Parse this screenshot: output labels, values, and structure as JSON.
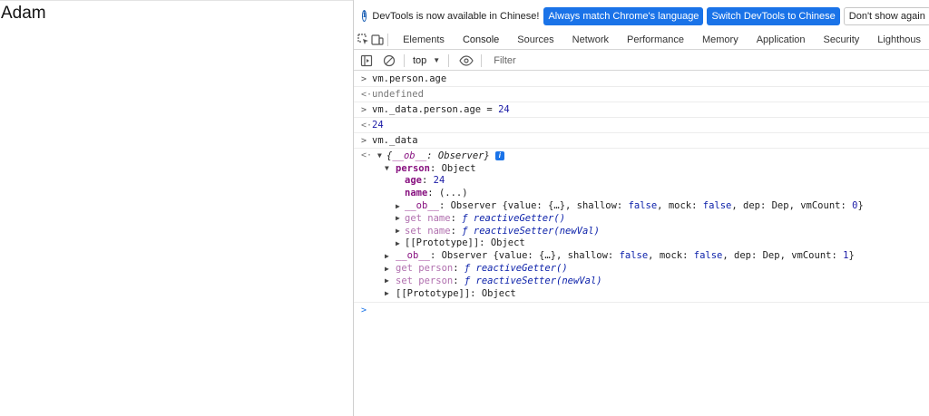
{
  "page": {
    "heading": "Adam"
  },
  "infobar": {
    "message": "DevTools is now available in Chinese!",
    "btn_match": "Always match Chrome's language",
    "btn_switch": "Switch DevTools to Chinese",
    "btn_dismiss": "Don't show again"
  },
  "tabs": [
    "Elements",
    "Console",
    "Sources",
    "Network",
    "Performance",
    "Memory",
    "Application",
    "Security",
    "Lighthous"
  ],
  "active_tab": "Console",
  "console_toolbar": {
    "context": "top",
    "filter_placeholder": "Filter"
  },
  "console": {
    "cmd1": "vm.person.age",
    "res1": "undefined",
    "cmd2_a": "vm._data.person.age = ",
    "cmd2_b": "24",
    "res2": "24",
    "cmd3": "vm._data",
    "obj_open": "{",
    "obj_ob_key": "__ob__",
    "obj_colon": ": ",
    "obj_ob_val": "Observer",
    "obj_close": "}",
    "info_badge": "i",
    "person_key": "person",
    "person_val": ": Object",
    "age_key": "age",
    "age_sep": ": ",
    "age_val": "24",
    "name_key": "name",
    "name_val": ": (...)",
    "ob1_key": "__ob__",
    "ob1_pre": ": Observer {value: {…}, shallow: ",
    "ob1_shallow": "false",
    "ob1_mid": ", mock: ",
    "ob1_mock": "false",
    "ob1_dep": ", dep: Dep, vmCount: ",
    "ob1_count": "0",
    "ob1_end": "}",
    "getname_key": "get name",
    "getname_sep": ": ",
    "getname_val": "ƒ reactiveGetter()",
    "setname_key": "set name",
    "setname_sep": ": ",
    "setname_val": "ƒ reactiveSetter(newVal)",
    "proto1": "[[Prototype]]: Object",
    "ob2_key": "__ob__",
    "ob2_pre": ": Observer {value: {…}, shallow: ",
    "ob2_shallow": "false",
    "ob2_mid": ", mock: ",
    "ob2_mock": "false",
    "ob2_dep": ", dep: Dep, vmCount: ",
    "ob2_count": "1",
    "ob2_end": "}",
    "getperson_key": "get person",
    "getperson_sep": ": ",
    "getperson_val": "ƒ reactiveGetter()",
    "setperson_key": "set person",
    "setperson_sep": ": ",
    "setperson_val": "ƒ reactiveSetter(newVal)",
    "proto2": "[[Prototype]]: Object"
  },
  "colors": {
    "accent": "#1a73e8",
    "keyword": "#881280",
    "number": "#1a1aa6"
  }
}
